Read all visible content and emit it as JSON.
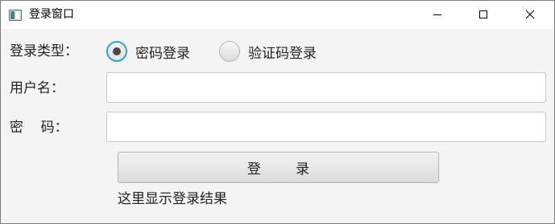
{
  "window": {
    "title": "登录窗口"
  },
  "form": {
    "login_type_label": "登录类型：",
    "login_type_options": [
      {
        "label": "密码登录",
        "selected": true
      },
      {
        "label": "验证码登录",
        "selected": false
      }
    ],
    "username_label": "用户名：",
    "username_value": "",
    "password_label": "密    码：",
    "password_value": "",
    "login_button_label": "登        录",
    "result_text": "这里显示登录结果"
  },
  "colors": {
    "accent": "#2fa3d6",
    "background": "#f4f4f4",
    "titlebar": "#ffffff"
  },
  "icons": {
    "app": "app-window-icon",
    "minimize": "minimize-icon",
    "maximize": "maximize-icon",
    "close": "close-icon"
  }
}
